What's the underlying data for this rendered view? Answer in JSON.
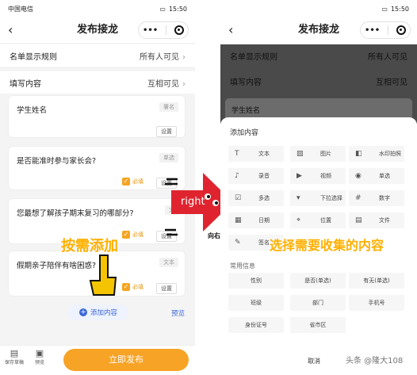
{
  "left": {
    "status_left": "中国电信",
    "status_time": "15:50",
    "title": "发布接龙",
    "capsule_dots": "•••",
    "rows": [
      {
        "label": "名单显示规则",
        "value": "所有人可见"
      },
      {
        "label": "填写内容",
        "value": "互相可见"
      }
    ],
    "cards": [
      {
        "question": "学生姓名",
        "tag": "署名",
        "setting": "设置"
      },
      {
        "question": "是否能准时参与家长会?",
        "tag": "单选",
        "required": "必填",
        "setting": "设置"
      },
      {
        "question": "您最想了解孩子期末复习的哪部分?",
        "tag": "文",
        "required": "必填",
        "setting": "设置"
      },
      {
        "question": "假期亲子陪伴有啥困惑?",
        "tag": "文本",
        "required": "必填",
        "setting": "设置"
      }
    ],
    "add_button": "添加内容",
    "preview": "预览",
    "bottom_items": [
      "保存草稿",
      "预览"
    ],
    "publish": "立即发布"
  },
  "annotations": {
    "left_caption": "按需添加",
    "arrow_text": "right",
    "arrow_sub": "向右跑",
    "right_caption": "选择需要收集的内容",
    "watermark": "头条 @隆大108"
  },
  "right": {
    "status_time": "15:50",
    "title": "发布接龙",
    "capsule_dots": "•••",
    "dim_rows": [
      {
        "label": "名单显示规则",
        "value": "所有人可见"
      },
      {
        "label": "填写内容",
        "value": "互相可见"
      },
      {
        "label": "学生姓名",
        "value": ""
      }
    ],
    "sheet_title": "添加内容",
    "items": [
      "文本",
      "图片",
      "水印拍照",
      "录音",
      "视频",
      "单选",
      "多选",
      "下拉选择",
      "数字",
      "日期",
      "位置",
      "文件",
      "签名"
    ],
    "common_title": "常用信息",
    "common": [
      "性别",
      "是否(单选)",
      "有无(单选)",
      "班级",
      "部门",
      "手机号",
      "身份证号",
      "省市区"
    ],
    "cancel": "取消"
  }
}
